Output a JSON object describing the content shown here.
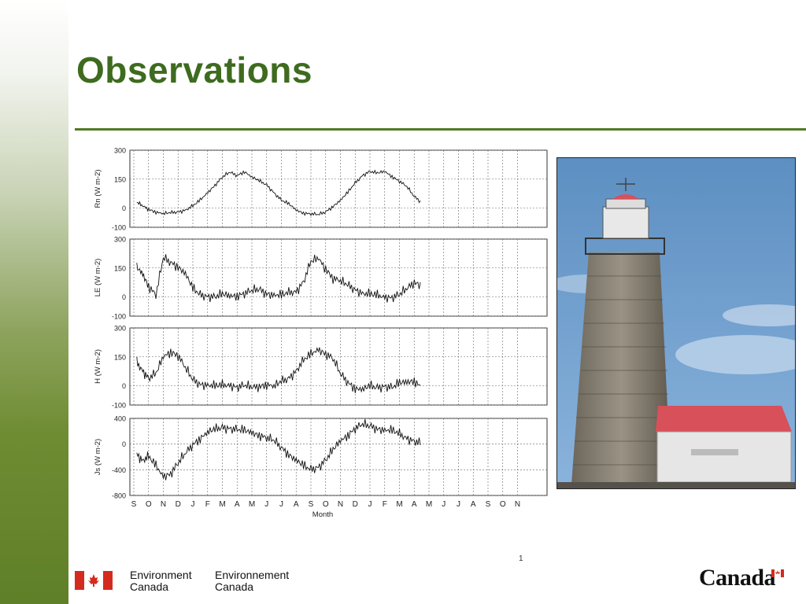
{
  "slide": {
    "title": "Observations"
  },
  "footer": {
    "env_en_line1": "Environment",
    "env_en_line2": "Canada",
    "env_fr_line1": "Environnement",
    "env_fr_line2": "Canada",
    "wordmark": "Canada",
    "page_marker": "1"
  },
  "colors": {
    "title": "#3e6b1f",
    "rule": "#4f7a23",
    "flag_red": "#d52b1e",
    "sky": "#6f9fcc",
    "roof": "#d8505a"
  },
  "photo": {
    "subject": "lighthouse"
  },
  "chart_data": {
    "type": "line",
    "xlabel": "Month",
    "x_ticks": [
      "S",
      "O",
      "N",
      "D",
      "J",
      "F",
      "M",
      "A",
      "M",
      "J",
      "J",
      "A",
      "S",
      "O",
      "N",
      "D",
      "J",
      "F",
      "M",
      "A",
      "M",
      "J",
      "J",
      "A",
      "S",
      "O",
      "N"
    ],
    "grid": true,
    "panels": [
      {
        "name": "Rn",
        "ylabel": "Rn (W m-2)",
        "ylim": [
          -100,
          300
        ],
        "yticks": [
          300,
          150,
          0,
          -100
        ],
        "x": [
          0.2,
          0.6,
          1.0,
          1.5,
          2.0,
          2.5,
          3.0,
          3.5,
          4.0,
          4.5,
          5.0,
          5.5,
          6.0,
          6.5,
          7.0,
          7.5,
          8.0,
          8.5,
          9.0,
          9.5,
          10.0,
          10.5,
          11.0,
          11.5,
          12.0,
          12.5,
          13.0,
          13.5,
          14.0,
          14.5,
          15.0,
          15.5,
          16.0,
          16.5,
          17.0,
          17.5,
          18.0,
          18.5,
          19.0,
          19.5,
          20.0,
          20.5,
          21.0,
          21.5,
          22.0,
          22.5,
          23.0,
          23.5,
          24.0,
          24.6
        ],
        "values": [
          30,
          10,
          -5,
          -20,
          -30,
          -25,
          -20,
          -10,
          10,
          40,
          80,
          120,
          160,
          185,
          170,
          190,
          160,
          140,
          120,
          80,
          40,
          20,
          -10,
          -25,
          -30,
          -35,
          -20,
          10,
          40,
          80,
          130,
          170,
          190,
          180,
          190,
          165,
          140,
          110,
          60,
          30
        ]
      },
      {
        "name": "LE",
        "ylabel": "LE (W m-2)",
        "ylim": [
          -100,
          300
        ],
        "yticks": [
          300,
          150,
          0,
          -100
        ],
        "x": [
          0.2,
          0.6,
          1.0,
          1.5,
          2.0,
          2.5,
          3.0,
          3.5,
          4.0,
          4.5,
          5.0,
          5.5,
          6.0,
          6.5,
          7.0,
          7.5,
          8.0,
          8.5,
          9.0,
          9.5,
          10.0,
          10.5,
          11.0,
          11.5,
          12.0,
          12.5,
          13.0,
          13.5,
          14.0,
          14.5,
          15.0,
          15.5,
          16.0,
          16.5,
          17.0,
          17.5,
          18.0,
          18.5,
          19.0,
          19.5,
          20.0,
          20.5,
          21.0,
          21.5,
          22.0,
          22.5,
          23.0,
          23.5,
          24.0,
          24.6
        ],
        "values": [
          150,
          120,
          60,
          10,
          200,
          180,
          160,
          120,
          40,
          10,
          5,
          0,
          10,
          5,
          10,
          20,
          30,
          40,
          20,
          10,
          5,
          20,
          30,
          80,
          180,
          200,
          150,
          100,
          80,
          60,
          40,
          20,
          10,
          5,
          0,
          0,
          10,
          40,
          80,
          60
        ]
      },
      {
        "name": "H",
        "ylabel": "H (W m-2)",
        "ylim": [
          -100,
          300
        ],
        "yticks": [
          300,
          150,
          0,
          -100
        ],
        "x": [
          0.2,
          0.6,
          1.0,
          1.5,
          2.0,
          2.5,
          3.0,
          3.5,
          4.0,
          4.5,
          5.0,
          5.5,
          6.0,
          6.5,
          7.0,
          7.5,
          8.0,
          8.5,
          9.0,
          9.5,
          10.0,
          10.5,
          11.0,
          11.5,
          12.0,
          12.5,
          13.0,
          13.5,
          14.0,
          14.5,
          15.0,
          15.5,
          16.0,
          16.5,
          17.0,
          17.5,
          18.0,
          18.5,
          19.0,
          19.5,
          20.0,
          20.5,
          21.0,
          21.5,
          22.0,
          22.5,
          23.0,
          23.5,
          24.0,
          24.6
        ],
        "values": [
          120,
          80,
          40,
          60,
          150,
          180,
          160,
          90,
          30,
          10,
          5,
          -5,
          0,
          5,
          -5,
          0,
          -10,
          0,
          10,
          -5,
          20,
          40,
          80,
          130,
          160,
          190,
          170,
          140,
          60,
          20,
          -10,
          -20,
          -5,
          -10,
          0,
          -10,
          10,
          20,
          30,
          -10
        ]
      },
      {
        "name": "Js",
        "ylabel": "Js (W m-2)",
        "ylim": [
          -800,
          400
        ],
        "yticks": [
          400,
          0,
          -400,
          -800
        ],
        "x": [
          0.2,
          0.6,
          1.0,
          1.5,
          2.0,
          2.5,
          3.0,
          3.5,
          4.0,
          4.5,
          5.0,
          5.5,
          6.0,
          6.5,
          7.0,
          7.5,
          8.0,
          8.5,
          9.0,
          9.5,
          10.0,
          10.5,
          11.0,
          11.5,
          12.0,
          12.5,
          13.0,
          13.5,
          14.0,
          14.5,
          15.0,
          15.5,
          16.0,
          16.5,
          17.0,
          17.5,
          18.0,
          18.5,
          19.0,
          19.5,
          20.0,
          20.5,
          21.0,
          21.5,
          22.0,
          22.5,
          23.0,
          23.5,
          24.0,
          24.6
        ],
        "values": [
          -150,
          -250,
          -200,
          -350,
          -500,
          -450,
          -300,
          -150,
          0,
          100,
          180,
          220,
          260,
          250,
          220,
          200,
          180,
          150,
          100,
          50,
          -50,
          -150,
          -250,
          -350,
          -400,
          -350,
          -250,
          -100,
          50,
          150,
          250,
          300,
          280,
          250,
          220,
          200,
          150,
          100,
          50,
          0
        ]
      }
    ]
  }
}
